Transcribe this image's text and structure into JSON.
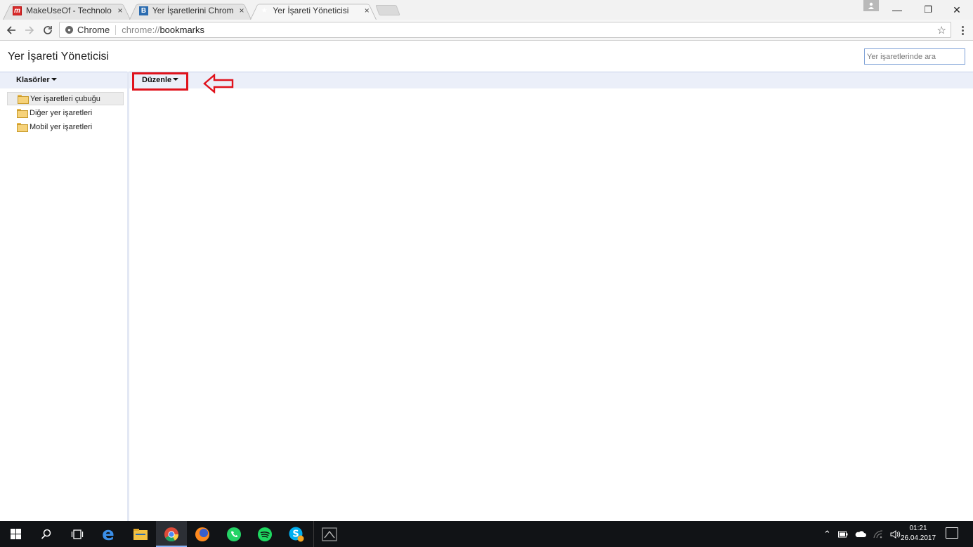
{
  "browser": {
    "tabs": [
      {
        "title": "MakeUseOf - Technology,",
        "favicon": "makeuseof-icon",
        "close": "×"
      },
      {
        "title": "Yer İşaretlerini Chrome'dan",
        "favicon": "b-icon",
        "close": "×"
      },
      {
        "title": "Yer İşareti Yöneticisi",
        "favicon": "star-icon",
        "close": "×"
      }
    ],
    "window_controls": {
      "minimize": "—",
      "restore": "❐",
      "close": "✕"
    },
    "omnibox": {
      "scheme_label": "Chrome",
      "url_prefix": "chrome://",
      "url_host": "bookmarks"
    }
  },
  "page": {
    "title": "Yer İşareti Yöneticisi",
    "search_placeholder": "Yer işaretlerinde ara",
    "folders_menu": "Klasörler",
    "organize_menu": "Düzenle",
    "folders": [
      {
        "label": "Yer işaretleri çubuğu",
        "selected": true
      },
      {
        "label": "Diğer yer işaretleri",
        "selected": false
      },
      {
        "label": "Mobil yer işaretleri",
        "selected": false
      }
    ]
  },
  "annotation": {
    "highlight_color": "#e0121c"
  },
  "taskbar": {
    "apps": [
      "windows-start-icon",
      "search-icon",
      "task-view-icon",
      "edge-icon",
      "file-explorer-icon",
      "chrome-icon",
      "firefox-icon",
      "whatsapp-icon",
      "spotify-icon",
      "skype-icon",
      "app-icon"
    ],
    "time": "01:21",
    "date": "26.04.2017"
  }
}
